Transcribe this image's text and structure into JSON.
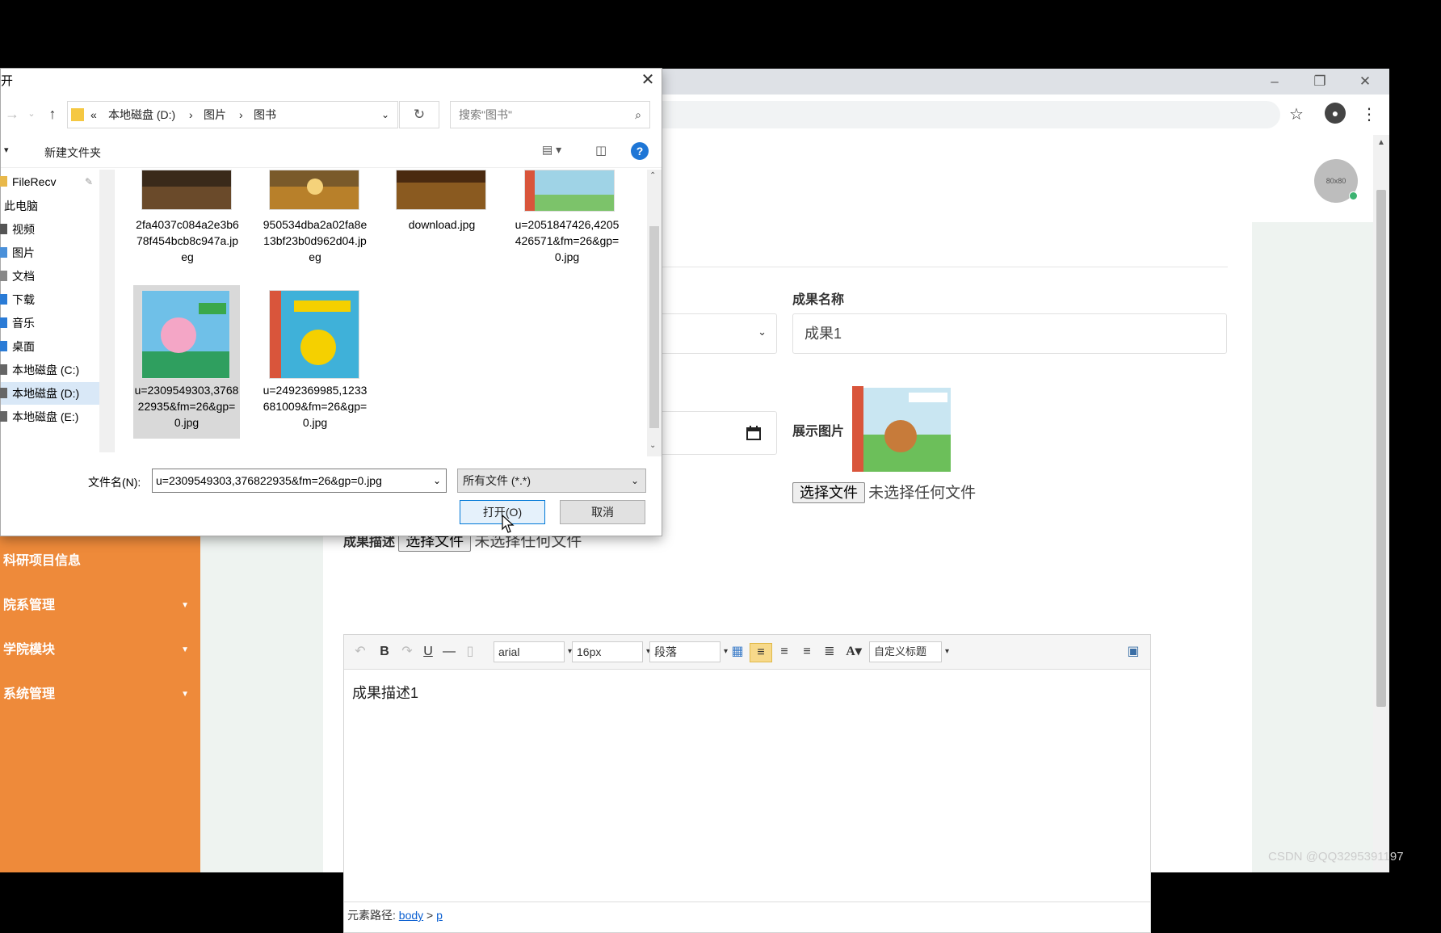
{
  "browser": {
    "window_controls": [
      "–",
      "❐",
      "✕"
    ]
  },
  "header": {
    "avatar_text": "80x80"
  },
  "sidebar": {
    "items": [
      {
        "label": "科研项目信息",
        "has_arrow": false
      },
      {
        "label": "院系管理",
        "has_arrow": true
      },
      {
        "label": "学院模块",
        "has_arrow": true
      },
      {
        "label": "系统管理",
        "has_arrow": true
      }
    ]
  },
  "form": {
    "name_label": "成果名称",
    "name_value": "成果1",
    "image_label": "展示图片",
    "image_file_button": "选择文件",
    "image_file_status": "未选择任何文件",
    "desc_label": "成果描述",
    "desc_file_button": "选择文件",
    "desc_file_status": "未选择任何文件"
  },
  "editor": {
    "font_family": "arial",
    "font_size": "16px",
    "paragraph": "段落",
    "custom_title": "自定义标题",
    "content": "成果描述1",
    "path_label": "元素路径:",
    "path_body": "body",
    "path_sep": ">",
    "path_p": "p"
  },
  "dialog": {
    "title": "开",
    "address": {
      "prefix": "«",
      "parts": [
        "本地磁盘 (D:)",
        "图片",
        "图书"
      ],
      "sep": "›"
    },
    "search_placeholder": "搜索\"图书\"",
    "new_folder": "新建文件夹",
    "nav_items": [
      {
        "label": "FileRecv",
        "color": "#e8b84a"
      },
      {
        "label": "此电脑",
        "color": "#4a90d9"
      },
      {
        "label": "视频",
        "color": "#555555"
      },
      {
        "label": "图片",
        "color": "#4a90d9"
      },
      {
        "label": "文档",
        "color": "#888888"
      },
      {
        "label": "下载",
        "color": "#2a7bd6"
      },
      {
        "label": "音乐",
        "color": "#2a7bd6"
      },
      {
        "label": "桌面",
        "color": "#2a7bd6"
      },
      {
        "label": "本地磁盘 (C:)",
        "color": "#666666"
      },
      {
        "label": "本地磁盘 (D:)",
        "color": "#666666"
      },
      {
        "label": "本地磁盘 (E:)",
        "color": "#666666"
      }
    ],
    "files": [
      {
        "name": "2fa4037c084a2e3b678f454bcb8c947a.jpeg"
      },
      {
        "name": "950534dba2a02fa8e13bf23b0d962d04.jpeg"
      },
      {
        "name": "download.jpg"
      },
      {
        "name": "u=2051847426,4205426571&fm=26&gp=0.jpg"
      },
      {
        "name": "u=2309549303,376822935&fm=26&gp=0.jpg"
      },
      {
        "name": "u=2492369985,1233681009&fm=26&gp=0.jpg"
      }
    ],
    "filename_label": "文件名(N):",
    "filename_value": "u=2309549303,376822935&fm=26&gp=0.jpg",
    "filetype": "所有文件 (*.*)",
    "open_button": "打开(O)",
    "cancel_button": "取消"
  },
  "watermark": "CSDN @QQ3295391197"
}
